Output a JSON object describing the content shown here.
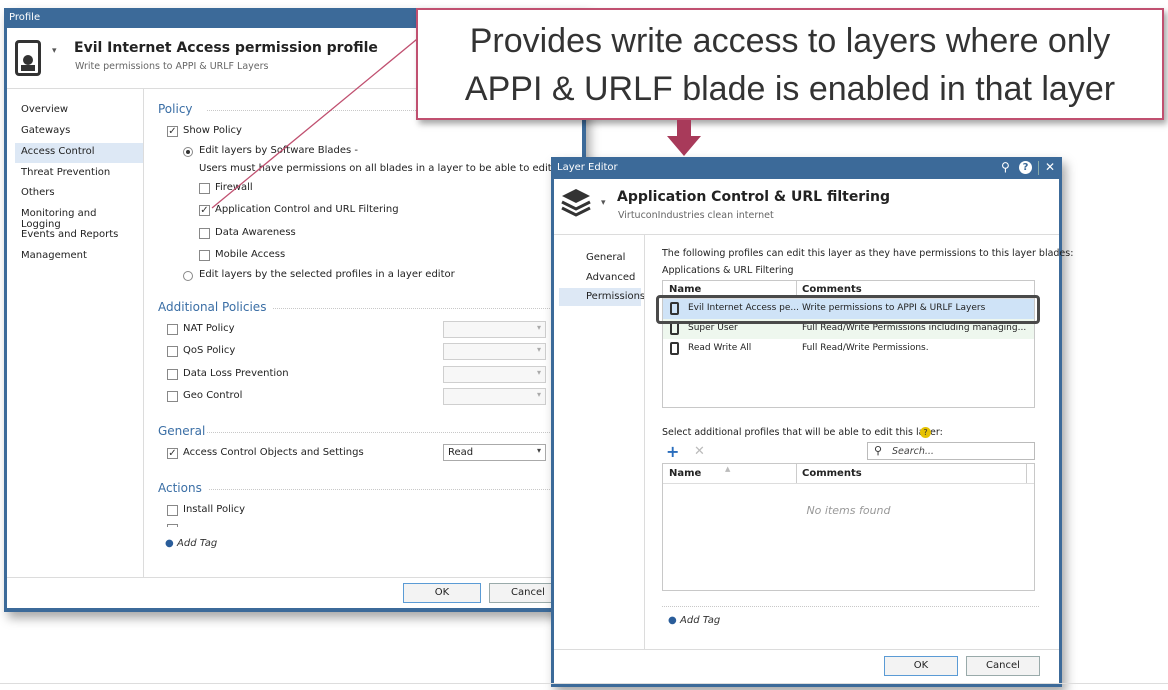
{
  "profile_window": {
    "title": "Profile",
    "profile_name": "Evil Internet Access permission profile",
    "profile_desc": "Write permissions to APPI & URLF Layers",
    "nav": [
      "Overview",
      "Gateways",
      "Access Control",
      "Threat Prevention",
      "Others",
      "Monitoring and Logging",
      "Events and Reports",
      "Management"
    ],
    "policy": {
      "heading": "Policy",
      "show_policy": "Show Policy",
      "edit_by_blades": "Edit layers by Software Blades -",
      "blades_note": "Users must have permissions on all blades in a layer to be able to edit a layer",
      "firewall": "Firewall",
      "appi": "Application Control and URL Filtering",
      "data_awareness": "Data Awareness",
      "mobile_access": "Mobile Access",
      "edit_by_profiles": "Edit layers by the selected profiles in a layer editor"
    },
    "additional": {
      "heading": "Additional Policies",
      "items": [
        "NAT Policy",
        "QoS Policy",
        "Data Loss Prevention",
        "Geo Control"
      ]
    },
    "general": {
      "heading": "General",
      "acos": "Access Control Objects and Settings",
      "acos_value": "Read"
    },
    "actions": {
      "heading": "Actions",
      "install_policy": "Install Policy"
    },
    "add_tag": "Add Tag",
    "ok": "OK",
    "cancel": "Cancel"
  },
  "callout": {
    "line1": "Provides write access to layers where only",
    "line2": "APPI & URLF blade is enabled in that layer"
  },
  "layer_editor": {
    "title": "Layer Editor",
    "layer_name": "Application Control & URL filtering",
    "layer_desc": "VirtuconIndustries clean internet",
    "nav": [
      "General",
      "Advanced",
      "Permissions"
    ],
    "info_line1": "The following profiles can edit this layer as they have permissions to this layer blades:",
    "info_line2": "Applications & URL Filtering",
    "columns": [
      "Name",
      "Comments"
    ],
    "rows": [
      {
        "name": "Evil Internet Access pe...",
        "comment": "Write permissions to APPI & URLF Layers"
      },
      {
        "name": "Super User",
        "comment": "Full Read/Write Permissions including managing..."
      },
      {
        "name": "Read Write All",
        "comment": "Full Read/Write Permissions."
      }
    ],
    "additional_label": "Select additional profiles that will be able to edit this layer:",
    "search_placeholder": "Search...",
    "no_items": "No items found",
    "add_tag": "Add Tag",
    "ok": "OK",
    "cancel": "Cancel"
  }
}
